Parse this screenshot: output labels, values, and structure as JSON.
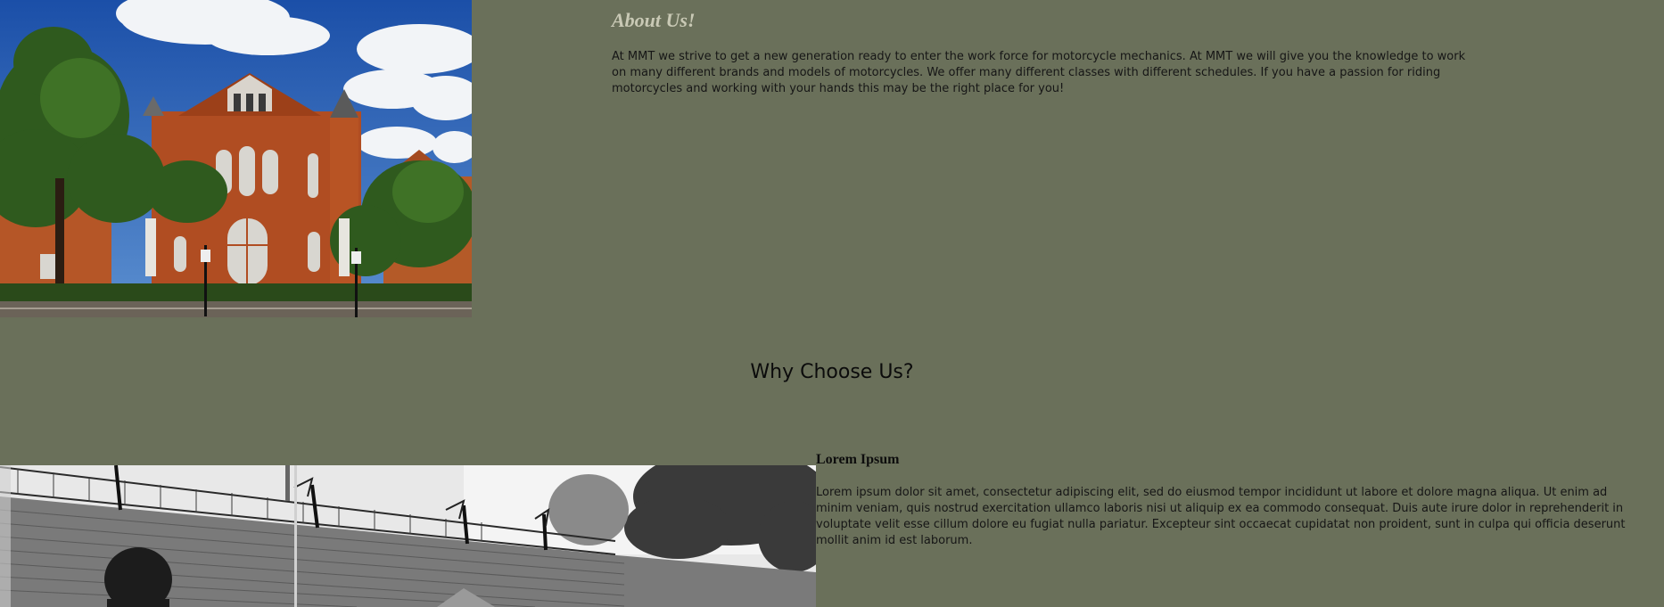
{
  "about": {
    "title": "About Us!",
    "text": "At MMT we strive to get a new generation ready to enter the work force for motorcycle mechanics. At MMT we will give you the knowledge to work on many different brands and models of motorcycles. We offer many different classes with different schedules. If you have a passion for riding motorcycles and working with your hands this may be the right place for you!"
  },
  "why": {
    "title": "Why Choose Us?"
  },
  "lorem": {
    "title": "Lorem Ipsum",
    "text": "Lorem ipsum dolor sit amet, consectetur adipiscing elit, sed do eiusmod tempor incididunt ut labore et dolore magna aliqua. Ut enim ad minim veniam, quis nostrud exercitation ullamco laboris nisi ut aliquip ex ea commodo consequat. Duis aute irure dolor in reprehenderit in voluptate velit esse cillum dolore eu fugiat nulla pariatur. Excepteur sint occaecat cupidatat non proident, sunt in culpa qui officia deserunt mollit anim id est laborum."
  },
  "images": {
    "building": "campus-building-photo",
    "workshop": "black-and-white-workshop-photo"
  },
  "colors": {
    "background": "#6a705a",
    "about_title": "#c9c9b5",
    "text": "#161616"
  }
}
